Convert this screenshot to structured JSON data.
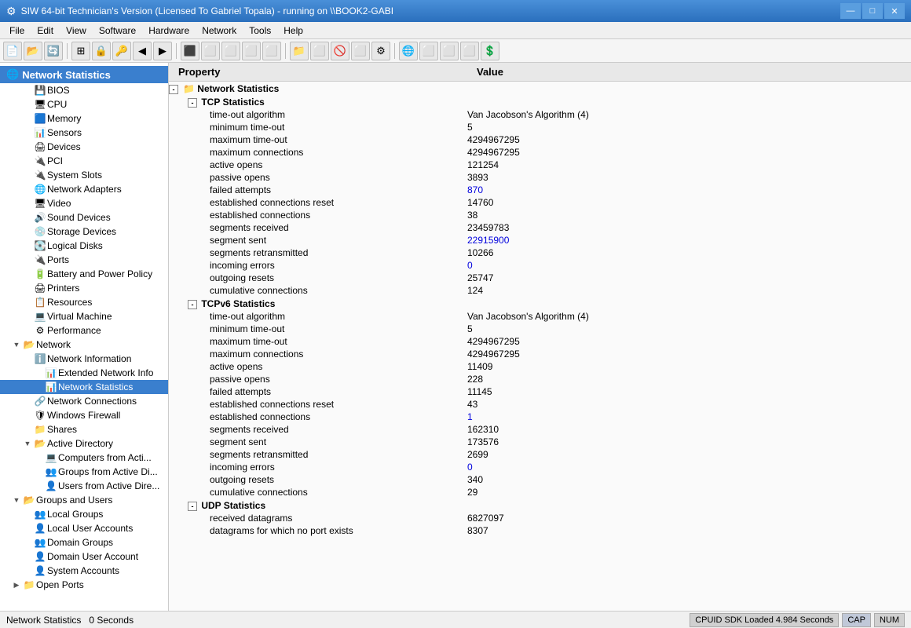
{
  "titlebar": {
    "title": "SIW 64-bit Technician's Version (Licensed To Gabriel Topala) - running on \\\\BOOK2-GABI",
    "icon": "⚙",
    "minimize": "—",
    "maximize": "□",
    "close": "✕"
  },
  "menubar": {
    "items": [
      "File",
      "Edit",
      "View",
      "Software",
      "Hardware",
      "Network",
      "Tools",
      "Help"
    ]
  },
  "toolbar": {
    "buttons": [
      "⬛",
      "⬛",
      "🔄",
      "⊞",
      "🔒",
      "🔑",
      "◀",
      "▶",
      "⬜",
      "⬜",
      "⬜",
      "⬜",
      "⬜",
      "⬜",
      "📁",
      "⬜",
      "🚫",
      "⬜",
      "⚙",
      "⬜",
      "⬜",
      "⬜",
      "⬜"
    ]
  },
  "sidebar": {
    "section_label": "Network Statistics",
    "items": [
      {
        "id": "bios",
        "label": "BIOS",
        "indent": 1,
        "icon": "💾",
        "type": "leaf"
      },
      {
        "id": "cpu",
        "label": "CPU",
        "indent": 1,
        "icon": "🖥",
        "type": "leaf"
      },
      {
        "id": "memory",
        "label": "Memory",
        "indent": 1,
        "icon": "🔲",
        "type": "leaf"
      },
      {
        "id": "sensors",
        "label": "Sensors",
        "indent": 1,
        "icon": "📊",
        "type": "leaf"
      },
      {
        "id": "devices",
        "label": "Devices",
        "indent": 1,
        "icon": "🖨",
        "type": "leaf"
      },
      {
        "id": "pci",
        "label": "PCI",
        "indent": 1,
        "icon": "🔌",
        "type": "leaf"
      },
      {
        "id": "system-slots",
        "label": "System Slots",
        "indent": 1,
        "icon": "🔌",
        "type": "leaf"
      },
      {
        "id": "network-adapters",
        "label": "Network Adapters",
        "indent": 1,
        "icon": "🌐",
        "type": "leaf"
      },
      {
        "id": "video",
        "label": "Video",
        "indent": 1,
        "icon": "🖥",
        "type": "leaf"
      },
      {
        "id": "sound-devices",
        "label": "Sound Devices",
        "indent": 1,
        "icon": "🔊",
        "type": "leaf"
      },
      {
        "id": "storage-devices",
        "label": "Storage Devices",
        "indent": 1,
        "icon": "💿",
        "type": "leaf"
      },
      {
        "id": "logical-disks",
        "label": "Logical Disks",
        "indent": 1,
        "icon": "💽",
        "type": "leaf"
      },
      {
        "id": "ports",
        "label": "Ports",
        "indent": 1,
        "icon": "🔌",
        "type": "leaf"
      },
      {
        "id": "battery",
        "label": "Battery and Power Policy",
        "indent": 1,
        "icon": "🔋",
        "type": "leaf"
      },
      {
        "id": "printers",
        "label": "Printers",
        "indent": 1,
        "icon": "🖨",
        "type": "leaf"
      },
      {
        "id": "resources",
        "label": "Resources",
        "indent": 1,
        "icon": "📋",
        "type": "leaf"
      },
      {
        "id": "virtual-machine",
        "label": "Virtual Machine",
        "indent": 1,
        "icon": "💻",
        "type": "leaf"
      },
      {
        "id": "performance",
        "label": "Performance",
        "indent": 1,
        "icon": "⚙",
        "type": "leaf"
      },
      {
        "id": "network",
        "label": "Network",
        "indent": 0,
        "icon": "🌐",
        "type": "group",
        "expanded": true
      },
      {
        "id": "network-information",
        "label": "Network Information",
        "indent": 1,
        "icon": "ℹ",
        "type": "leaf"
      },
      {
        "id": "extended-network",
        "label": "Extended Network Info",
        "indent": 2,
        "icon": "📊",
        "type": "leaf"
      },
      {
        "id": "network-statistics",
        "label": "Network Statistics",
        "indent": 2,
        "icon": "📊",
        "type": "leaf",
        "selected": true
      },
      {
        "id": "network-connections",
        "label": "Network Connections",
        "indent": 1,
        "icon": "🔗",
        "type": "leaf"
      },
      {
        "id": "windows-firewall",
        "label": "Windows Firewall",
        "indent": 1,
        "icon": "🛡",
        "type": "leaf"
      },
      {
        "id": "shares",
        "label": "Shares",
        "indent": 1,
        "icon": "📁",
        "type": "leaf"
      },
      {
        "id": "active-directory",
        "label": "Active Directory",
        "indent": 1,
        "icon": "📁",
        "type": "group",
        "expanded": true
      },
      {
        "id": "computers-from-active",
        "label": "Computers from Acti...",
        "indent": 2,
        "icon": "💻",
        "type": "leaf"
      },
      {
        "id": "groups-from-active",
        "label": "Groups from Active Di...",
        "indent": 2,
        "icon": "👥",
        "type": "leaf"
      },
      {
        "id": "users-from-active",
        "label": "Users from Active Dire...",
        "indent": 2,
        "icon": "👤",
        "type": "leaf"
      },
      {
        "id": "groups-users",
        "label": "Groups and Users",
        "indent": 0,
        "icon": "👥",
        "type": "group",
        "expanded": true
      },
      {
        "id": "local-groups",
        "label": "Local Groups",
        "indent": 1,
        "icon": "👥",
        "type": "leaf"
      },
      {
        "id": "local-user-accounts",
        "label": "Local User Accounts",
        "indent": 1,
        "icon": "👤",
        "type": "leaf"
      },
      {
        "id": "domain-groups",
        "label": "Domain Groups",
        "indent": 1,
        "icon": "👥",
        "type": "leaf"
      },
      {
        "id": "domain-user-account",
        "label": "Domain User Account",
        "indent": 1,
        "icon": "👤",
        "type": "leaf"
      },
      {
        "id": "system-accounts",
        "label": "System Accounts",
        "indent": 1,
        "icon": "👤",
        "type": "leaf"
      },
      {
        "id": "open-ports",
        "label": "Open Ports",
        "indent": 0,
        "icon": "🔌",
        "type": "group"
      }
    ]
  },
  "content": {
    "header": {
      "property": "Property",
      "value": "Value"
    },
    "sections": [
      {
        "id": "network-statistics",
        "label": "Network Statistics",
        "level": 0,
        "expand": "collapse",
        "subsections": [
          {
            "id": "tcp-statistics",
            "label": "TCP Statistics",
            "expand": "collapse",
            "rows": [
              {
                "property": "time-out algorithm",
                "value": "Van Jacobson's Algorithm (4)",
                "color": "black"
              },
              {
                "property": "minimum time-out",
                "value": "5",
                "color": "black"
              },
              {
                "property": "maximum time-out",
                "value": "4294967295",
                "color": "black"
              },
              {
                "property": "maximum connections",
                "value": "4294967295",
                "color": "black"
              },
              {
                "property": "active opens",
                "value": "121254",
                "color": "black"
              },
              {
                "property": "passive opens",
                "value": "3893",
                "color": "black"
              },
              {
                "property": "failed attempts",
                "value": "870",
                "color": "blue"
              },
              {
                "property": "established connections reset",
                "value": "14760",
                "color": "black"
              },
              {
                "property": "established connections",
                "value": "38",
                "color": "black"
              },
              {
                "property": "segments received",
                "value": "23459783",
                "color": "black"
              },
              {
                "property": "segment sent",
                "value": "22915900",
                "color": "blue"
              },
              {
                "property": "segments retransmitted",
                "value": "10266",
                "color": "black"
              },
              {
                "property": "incoming errors",
                "value": "0",
                "color": "blue"
              },
              {
                "property": "outgoing resets",
                "value": "25747",
                "color": "black"
              },
              {
                "property": "cumulative connections",
                "value": "124",
                "color": "black"
              }
            ]
          },
          {
            "id": "tcpv6-statistics",
            "label": "TCPv6 Statistics",
            "expand": "collapse",
            "rows": [
              {
                "property": "time-out algorithm",
                "value": "Van Jacobson's Algorithm (4)",
                "color": "black"
              },
              {
                "property": "minimum time-out",
                "value": "5",
                "color": "black"
              },
              {
                "property": "maximum time-out",
                "value": "4294967295",
                "color": "black"
              },
              {
                "property": "maximum connections",
                "value": "4294967295",
                "color": "black"
              },
              {
                "property": "active opens",
                "value": "11409",
                "color": "black"
              },
              {
                "property": "passive opens",
                "value": "228",
                "color": "black"
              },
              {
                "property": "failed attempts",
                "value": "11145",
                "color": "black"
              },
              {
                "property": "established connections reset",
                "value": "43",
                "color": "black"
              },
              {
                "property": "established connections",
                "value": "1",
                "color": "blue"
              },
              {
                "property": "segments received",
                "value": "162310",
                "color": "black"
              },
              {
                "property": "segment sent",
                "value": "173576",
                "color": "black"
              },
              {
                "property": "segments retransmitted",
                "value": "2699",
                "color": "black"
              },
              {
                "property": "incoming errors",
                "value": "0",
                "color": "blue"
              },
              {
                "property": "outgoing resets",
                "value": "340",
                "color": "black"
              },
              {
                "property": "cumulative connections",
                "value": "29",
                "color": "black"
              }
            ]
          },
          {
            "id": "udp-statistics",
            "label": "UDP Statistics",
            "expand": "collapse",
            "rows": [
              {
                "property": "received datagrams",
                "value": "6827097",
                "color": "black"
              },
              {
                "property": "datagrams for which no port exists",
                "value": "8307",
                "color": "black"
              }
            ]
          }
        ]
      }
    ]
  },
  "statusbar": {
    "left": "Network Statistics",
    "seconds": "0 Seconds",
    "cpuid": "CPUID SDK Loaded 4.984 Seconds",
    "cap": "CAP",
    "num": "NUM"
  }
}
